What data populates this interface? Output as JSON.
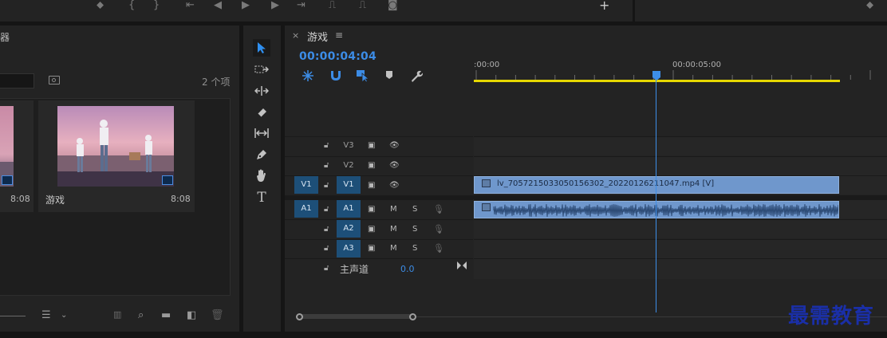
{
  "project": {
    "title": "器",
    "item_count": "2 个项",
    "clips": [
      {
        "name": "",
        "duration": "8:08"
      },
      {
        "name": "游戏",
        "duration": "8:08"
      }
    ]
  },
  "timeline": {
    "close_glyph": "×",
    "sequence_name": "游戏",
    "menu_glyph": "≡",
    "timecode": "00:00:04:04",
    "ruler_labels": [
      ":00:00",
      "00:00:05:00"
    ],
    "tracks": {
      "video": [
        {
          "label": "V3"
        },
        {
          "label": "V2"
        },
        {
          "label": "V1",
          "source": "V1"
        }
      ],
      "audio": [
        {
          "label": "A1",
          "source": "A1"
        },
        {
          "label": "A2"
        },
        {
          "label": "A3"
        }
      ],
      "mute": "M",
      "solo": "S"
    },
    "video_clip_label": "lv_7057215033050156302_20220126211047.mp4 [V]",
    "master_label": "主声道",
    "master_value": "0.0"
  },
  "watermark": "最需教育",
  "colors": {
    "accent": "#3c8ce6",
    "clip": "#6f97cc",
    "work_area": "#e6d700",
    "track_patch": "#1d4f78"
  }
}
